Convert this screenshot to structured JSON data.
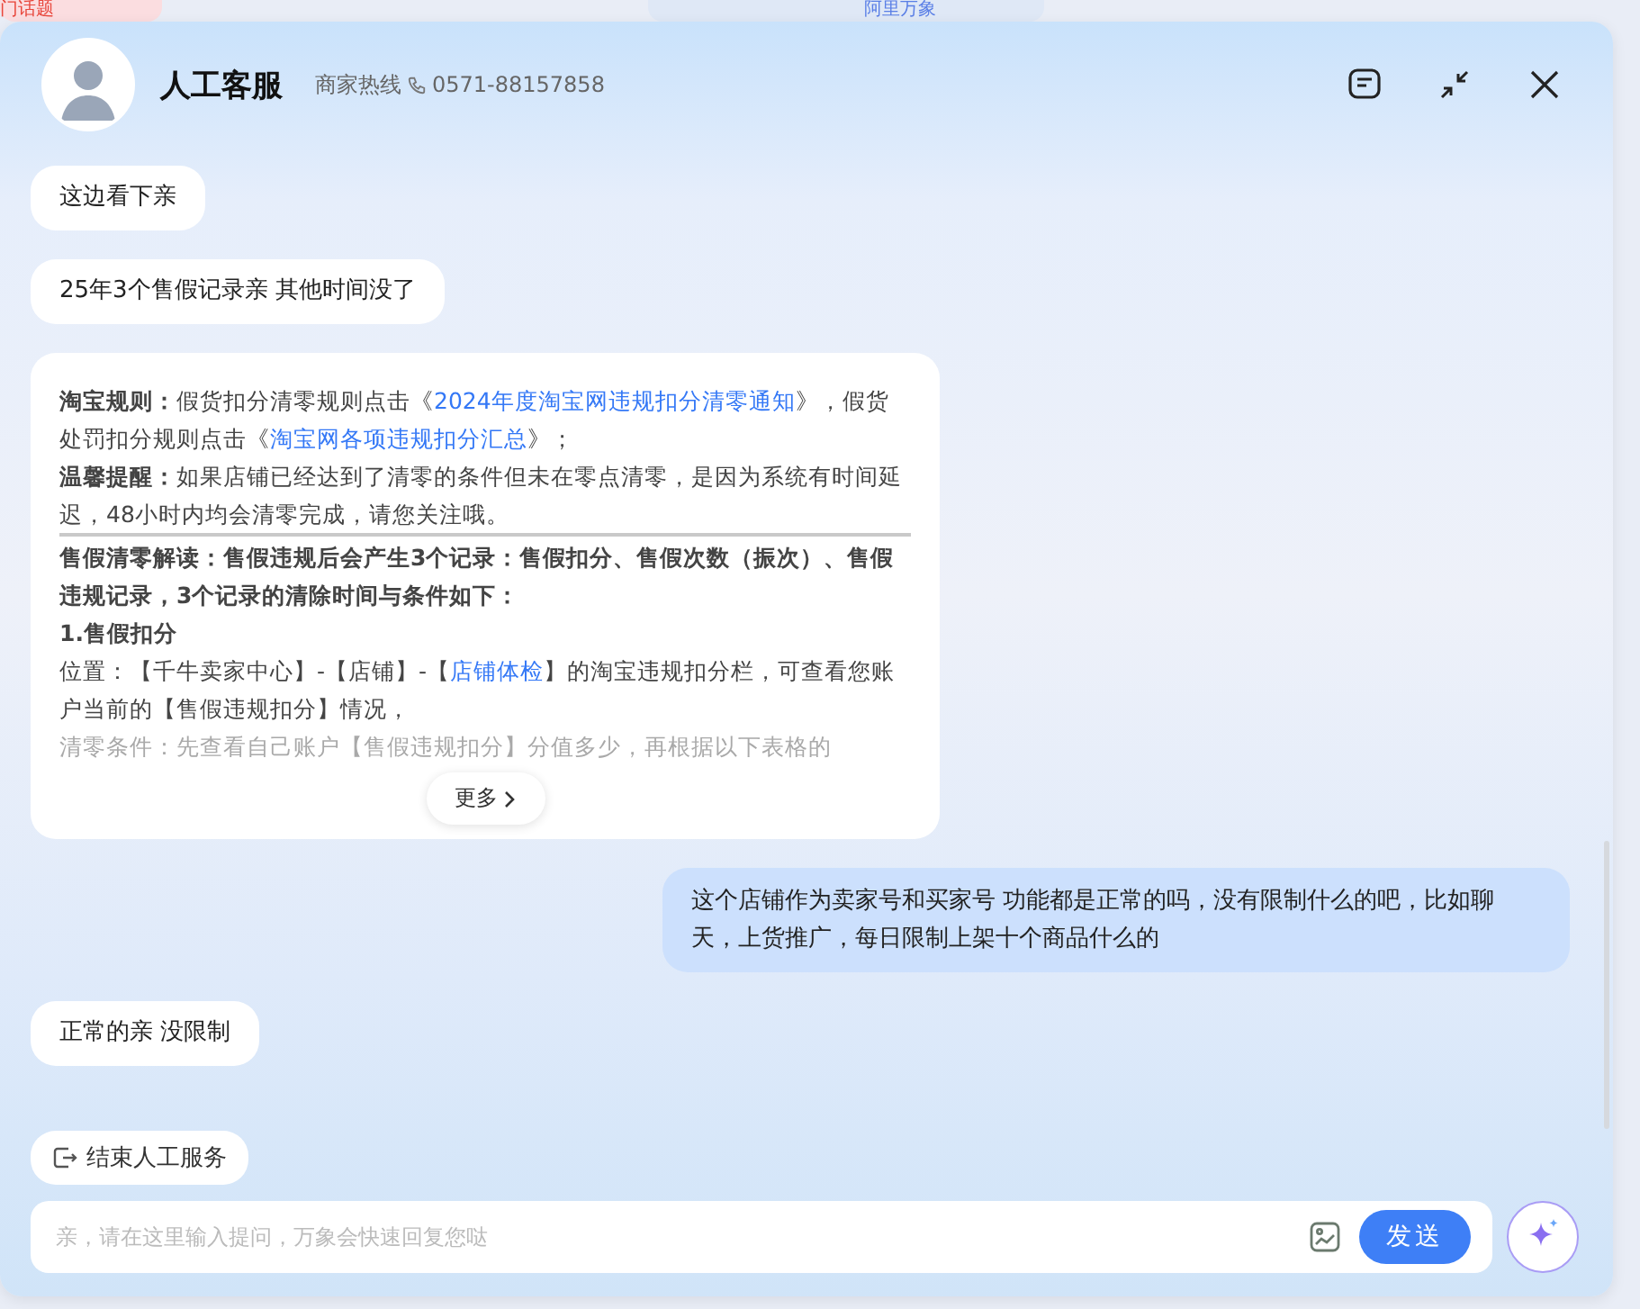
{
  "backdrop": {
    "items": [
      {
        "text": "门话题",
        "kind": "topic"
      },
      {
        "text": "阿里万象",
        "kind": "app"
      }
    ]
  },
  "header": {
    "title": "人工客服",
    "hotline_label": "商家热线",
    "hotline_number": "0571-88157858"
  },
  "messages": [
    {
      "kind": "agent",
      "text": "这边看下亲"
    },
    {
      "kind": "agent",
      "text": "25年3个售假记录亲 其他时间没了"
    },
    {
      "kind": "card",
      "more": "更多",
      "paragraphs": [
        {
          "kind": "text",
          "parts": [
            {
              "kind": "bold",
              "text": "淘宝规则："
            },
            {
              "kind": "plain",
              "text": "假货扣分清零规则点击《"
            },
            {
              "kind": "link",
              "text": "2024年度淘宝网违规扣分清零通知"
            },
            {
              "kind": "plain",
              "text": "》，假货处罚扣分规则点击《"
            },
            {
              "kind": "link",
              "text": "淘宝网各项违规扣分汇总"
            },
            {
              "kind": "plain",
              "text": "》；"
            }
          ]
        },
        {
          "kind": "text",
          "parts": [
            {
              "kind": "bold",
              "text": "温馨提醒："
            },
            {
              "kind": "plain",
              "text": "如果店铺已经达到了清零的条件但未在零点清零，是因为系统有时间延迟，48小时内均会清零完成，请您关注哦。"
            }
          ]
        },
        {
          "kind": "divider"
        },
        {
          "kind": "text",
          "parts": [
            {
              "kind": "bold",
              "text": "售假清零解读：售假违规后会产生3个记录：售假扣分、售假次数（振次）、售假违规记录，3个记录的清除时间与条件如下："
            }
          ]
        },
        {
          "kind": "text",
          "parts": [
            {
              "kind": "bold",
              "text": "1.售假扣分"
            }
          ]
        },
        {
          "kind": "text",
          "parts": [
            {
              "kind": "plain",
              "text": "位置：【千牛卖家中心】-【店铺】-【"
            },
            {
              "kind": "link",
              "text": "店铺体检"
            },
            {
              "kind": "plain",
              "text": "】的淘宝违规扣分栏，可查看您账户当前的【售假违规扣分】情况，"
            }
          ]
        },
        {
          "kind": "text",
          "faded": true,
          "parts": [
            {
              "kind": "plain",
              "text": "清零条件：先查看自己账户【售假违规扣分】分值多少，再根据以下表格的"
            }
          ]
        }
      ]
    },
    {
      "kind": "user",
      "text": "这个店铺作为卖家号和买家号 功能都是正常的吗，没有限制什么的吧，比如聊天，上货推广，每日限制上架十个商品什么的"
    },
    {
      "kind": "agent",
      "text": "正常的亲 没限制"
    }
  ],
  "end_service": "结束人工服务",
  "composer": {
    "placeholder": "亲，请在这里输入提问，万象会快速回复您哒",
    "send": "发送"
  }
}
